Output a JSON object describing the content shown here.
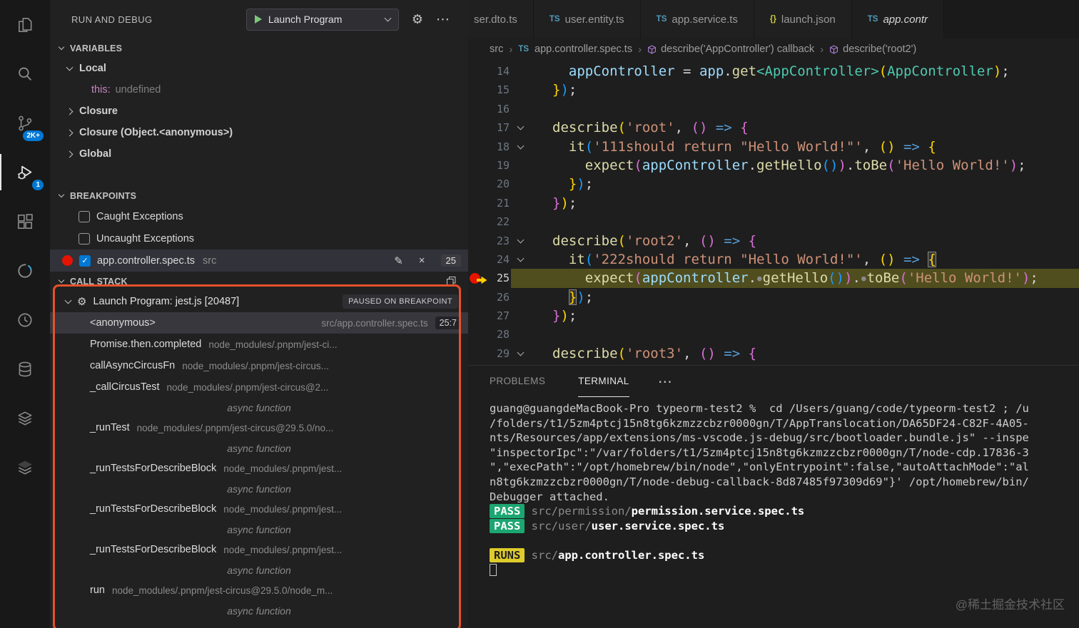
{
  "activity_bar": {
    "items": [
      {
        "name": "explorer"
      },
      {
        "name": "search"
      },
      {
        "name": "source-control",
        "badge": "2K+"
      },
      {
        "name": "run-and-debug",
        "badge": "1",
        "active": true
      },
      {
        "name": "extensions"
      },
      {
        "name": "ring-extension"
      },
      {
        "name": "clock-extension"
      },
      {
        "name": "database-extension"
      },
      {
        "name": "layers-extension"
      },
      {
        "name": "layers-extension-2"
      }
    ]
  },
  "sidebar": {
    "title": "RUN AND DEBUG",
    "toolbar": {
      "launch_label": "Launch Program"
    },
    "variables": {
      "header": "VARIABLES",
      "scopes": [
        {
          "label": "Local",
          "expanded": true,
          "children": [
            {
              "name": "this:",
              "value": "undefined"
            }
          ]
        },
        {
          "label": "Closure",
          "expanded": false
        },
        {
          "label": "Closure (Object.<anonymous>)",
          "expanded": false
        },
        {
          "label": "Global",
          "expanded": false
        }
      ]
    },
    "breakpoints": {
      "header": "BREAKPOINTS",
      "items": [
        {
          "label": "Caught Exceptions",
          "checked": false
        },
        {
          "label": "Uncaught Exceptions",
          "checked": false
        },
        {
          "label": "app.controller.spec.ts",
          "detail": "src",
          "checked": true,
          "bp": true,
          "line": "25",
          "selected": true
        }
      ]
    },
    "call_stack": {
      "header": "CALL STACK",
      "session": "Launch Program: jest.js [20487]",
      "status_badge": "PAUSED ON BREAKPOINT",
      "async_label": "async function",
      "frames": [
        {
          "name": "<anonymous>",
          "path": "src/app.controller.spec.ts",
          "line": "25:7",
          "selected": true
        },
        {
          "name": "Promise.then.completed",
          "path": "node_modules/.pnpm/jest-ci..."
        },
        {
          "name": "callAsyncCircusFn",
          "path": "node_modules/.pnpm/jest-circus..."
        },
        {
          "name": "_callCircusTest",
          "path": "node_modules/.pnpm/jest-circus@2...",
          "async": true
        },
        {
          "name": "_runTest",
          "path": "node_modules/.pnpm/jest-circus@29.5.0/no...",
          "async": true
        },
        {
          "name": "_runTestsForDescribeBlock",
          "path": "node_modules/.pnpm/jest...",
          "async": true
        },
        {
          "name": "_runTestsForDescribeBlock",
          "path": "node_modules/.pnpm/jest...",
          "async": true
        },
        {
          "name": "_runTestsForDescribeBlock",
          "path": "node_modules/.pnpm/jest...",
          "async": true
        },
        {
          "name": "run",
          "path": "node_modules/.pnpm/jest-circus@29.5.0/node_m...",
          "async": true
        }
      ]
    }
  },
  "editor": {
    "tabs": [
      {
        "label": "ser.dto.ts",
        "icon": "TS",
        "icon_color": "#519aba",
        "cut": true
      },
      {
        "label": "user.entity.ts",
        "icon": "TS",
        "icon_color": "#519aba"
      },
      {
        "label": "app.service.ts",
        "icon": "TS",
        "icon_color": "#519aba"
      },
      {
        "label": "launch.json",
        "icon": "{}",
        "icon_color": "#cbcb41"
      },
      {
        "label": "app.contr",
        "icon": "TS",
        "icon_color": "#519aba",
        "italic": true,
        "active": true
      }
    ],
    "breadcrumbs": [
      {
        "label": "src"
      },
      {
        "label": "app.controller.spec.ts",
        "icon": "TS"
      },
      {
        "label": "describe('AppController') callback",
        "icon": "cube"
      },
      {
        "label": "describe('root2')",
        "icon": "cube"
      }
    ],
    "code": {
      "lines": [
        {
          "n": 14,
          "t": [
            [
              "pl",
              "  "
            ],
            [
              "v",
              "appController"
            ],
            [
              "pl",
              " = "
            ],
            [
              "v",
              "app"
            ],
            [
              "pl",
              "."
            ],
            [
              "f",
              "get"
            ],
            [
              "t",
              "<AppController>"
            ],
            [
              "b1",
              "("
            ],
            [
              "t",
              "AppController"
            ],
            [
              "b1",
              ")"
            ],
            [
              "pl",
              ";"
            ]
          ]
        },
        {
          "n": 15,
          "t": [
            [
              "b1",
              "}"
            ],
            [
              "b3",
              ")"
            ],
            [
              "pl",
              ";"
            ]
          ]
        },
        {
          "n": 16,
          "t": []
        },
        {
          "n": 17,
          "fold": true,
          "t": [
            [
              "f",
              "describe"
            ],
            [
              "b1",
              "("
            ],
            [
              "s",
              "'root'"
            ],
            [
              "pl",
              ", "
            ],
            [
              "b2",
              "()"
            ],
            [
              "pl",
              " "
            ],
            [
              "a",
              "=>"
            ],
            [
              "pl",
              " "
            ],
            [
              "b2",
              "{"
            ]
          ]
        },
        {
          "n": 18,
          "fold": true,
          "t": [
            [
              "pl",
              "  "
            ],
            [
              "f",
              "it"
            ],
            [
              "b3",
              "("
            ],
            [
              "s",
              "'111should return \"Hello World!\"'"
            ],
            [
              "pl",
              ", "
            ],
            [
              "b1",
              "()"
            ],
            [
              "pl",
              " "
            ],
            [
              "a",
              "=>"
            ],
            [
              "pl",
              " "
            ],
            [
              "b1",
              "{"
            ]
          ]
        },
        {
          "n": 19,
          "t": [
            [
              "pl",
              "    "
            ],
            [
              "f",
              "expect"
            ],
            [
              "b2",
              "("
            ],
            [
              "v",
              "appController"
            ],
            [
              "pl",
              "."
            ],
            [
              "f",
              "getHello"
            ],
            [
              "b3",
              "()"
            ],
            [
              "b2",
              ")"
            ],
            [
              "pl",
              "."
            ],
            [
              "f",
              "toBe"
            ],
            [
              "b2",
              "("
            ],
            [
              "s",
              "'Hello World!'"
            ],
            [
              "b2",
              ")"
            ],
            [
              "pl",
              ";"
            ]
          ]
        },
        {
          "n": 20,
          "t": [
            [
              "pl",
              "  "
            ],
            [
              "b1",
              "}"
            ],
            [
              "b3",
              ")"
            ],
            [
              "pl",
              ";"
            ]
          ]
        },
        {
          "n": 21,
          "t": [
            [
              "b2",
              "}"
            ],
            [
              "b1",
              ")"
            ],
            [
              "pl",
              ";"
            ]
          ]
        },
        {
          "n": 22,
          "t": []
        },
        {
          "n": 23,
          "fold": true,
          "t": [
            [
              "f",
              "describe"
            ],
            [
              "b1",
              "("
            ],
            [
              "s",
              "'root2'"
            ],
            [
              "pl",
              ", "
            ],
            [
              "b2",
              "()"
            ],
            [
              "pl",
              " "
            ],
            [
              "a",
              "=>"
            ],
            [
              "pl",
              " "
            ],
            [
              "b2",
              "{"
            ]
          ]
        },
        {
          "n": 24,
          "fold": true,
          "t": [
            [
              "pl",
              "  "
            ],
            [
              "f",
              "it"
            ],
            [
              "b3",
              "("
            ],
            [
              "s",
              "'222should return \"Hello World!\"'"
            ],
            [
              "pl",
              ", "
            ],
            [
              "b1",
              "()"
            ],
            [
              "pl",
              " "
            ],
            [
              "a",
              "=>"
            ],
            [
              "pl",
              " "
            ],
            [
              "b1 bx",
              "{"
            ]
          ]
        },
        {
          "n": 25,
          "cur": true,
          "t": [
            [
              "pl",
              "    "
            ],
            [
              "f",
              "expect"
            ],
            [
              "b2",
              "("
            ],
            [
              "v",
              "appController"
            ],
            [
              "pl",
              "."
            ],
            [
              "dot",
              "●"
            ],
            [
              "f",
              "getHello"
            ],
            [
              "b3",
              "()"
            ],
            [
              "b2",
              ")"
            ],
            [
              "pl",
              "."
            ],
            [
              "dot",
              "●"
            ],
            [
              "f",
              "toBe"
            ],
            [
              "b2",
              "("
            ],
            [
              "s",
              "'Hello World!'"
            ],
            [
              "b2",
              ")"
            ],
            [
              "pl",
              ";"
            ]
          ]
        },
        {
          "n": 26,
          "t": [
            [
              "pl",
              "  "
            ],
            [
              "b1 bx",
              "}"
            ],
            [
              "b3",
              ")"
            ],
            [
              "pl",
              ";"
            ]
          ]
        },
        {
          "n": 27,
          "t": [
            [
              "b2",
              "}"
            ],
            [
              "b1",
              ")"
            ],
            [
              "pl",
              ";"
            ]
          ]
        },
        {
          "n": 28,
          "t": []
        },
        {
          "n": 29,
          "fold": true,
          "t": [
            [
              "f",
              "describe"
            ],
            [
              "b1",
              "("
            ],
            [
              "s",
              "'root3'"
            ],
            [
              "pl",
              ", "
            ],
            [
              "b2",
              "()"
            ],
            [
              "pl",
              " "
            ],
            [
              "a",
              "=>"
            ],
            [
              "pl",
              " "
            ],
            [
              "b2",
              "{"
            ]
          ]
        }
      ]
    }
  },
  "panel": {
    "tabs": [
      {
        "label": "PROBLEMS"
      },
      {
        "label": "TERMINAL",
        "active": true
      }
    ],
    "terminal": {
      "lines": [
        [
          [
            "txt",
            "guang@guangdeMacBook-Pro typeorm-test2 %  cd /Users/guang/code/typeorm-test2 ; /u"
          ]
        ],
        [
          [
            "txt",
            "/folders/t1/5zm4ptcj15n8tg6kzmzzcbzr0000gn/T/AppTranslocation/DA65DF24-C82F-4A05-"
          ]
        ],
        [
          [
            "txt",
            "nts/Resources/app/extensions/ms-vscode.js-debug/src/bootloader.bundle.js\" --inspe"
          ]
        ],
        [
          [
            "txt",
            "\"inspectorIpc\":\"/var/folders/t1/5zm4ptcj15n8tg6kzmzzcbzr0000gn/T/node-cdp.17836-3"
          ]
        ],
        [
          [
            "txt",
            "\",\"execPath\":\"/opt/homebrew/bin/node\",\"onlyEntrypoint\":false,\"autoAttachMode\":\"al"
          ]
        ],
        [
          [
            "txt",
            "n8tg6kzmzzcbzr0000gn/T/node-debug-callback-8d87485f97309d69\"}' /opt/homebrew/bin/"
          ]
        ],
        [
          [
            "txt",
            "Debugger attached."
          ]
        ],
        [
          [
            "pass",
            "PASS"
          ],
          [
            "dim",
            " src/permission/"
          ],
          [
            "bold",
            "permission.service.spec.ts"
          ]
        ],
        [
          [
            "pass",
            "PASS"
          ],
          [
            "dim",
            " src/user/"
          ],
          [
            "bold",
            "user.service.spec.ts"
          ]
        ],
        [],
        [
          [
            "runs",
            "RUNS"
          ],
          [
            "dim",
            " src/"
          ],
          [
            "bold",
            "app.controller.spec.ts"
          ]
        ],
        [
          [
            "cursor",
            ""
          ]
        ]
      ]
    }
  },
  "watermark": "@稀土掘金技术社区"
}
